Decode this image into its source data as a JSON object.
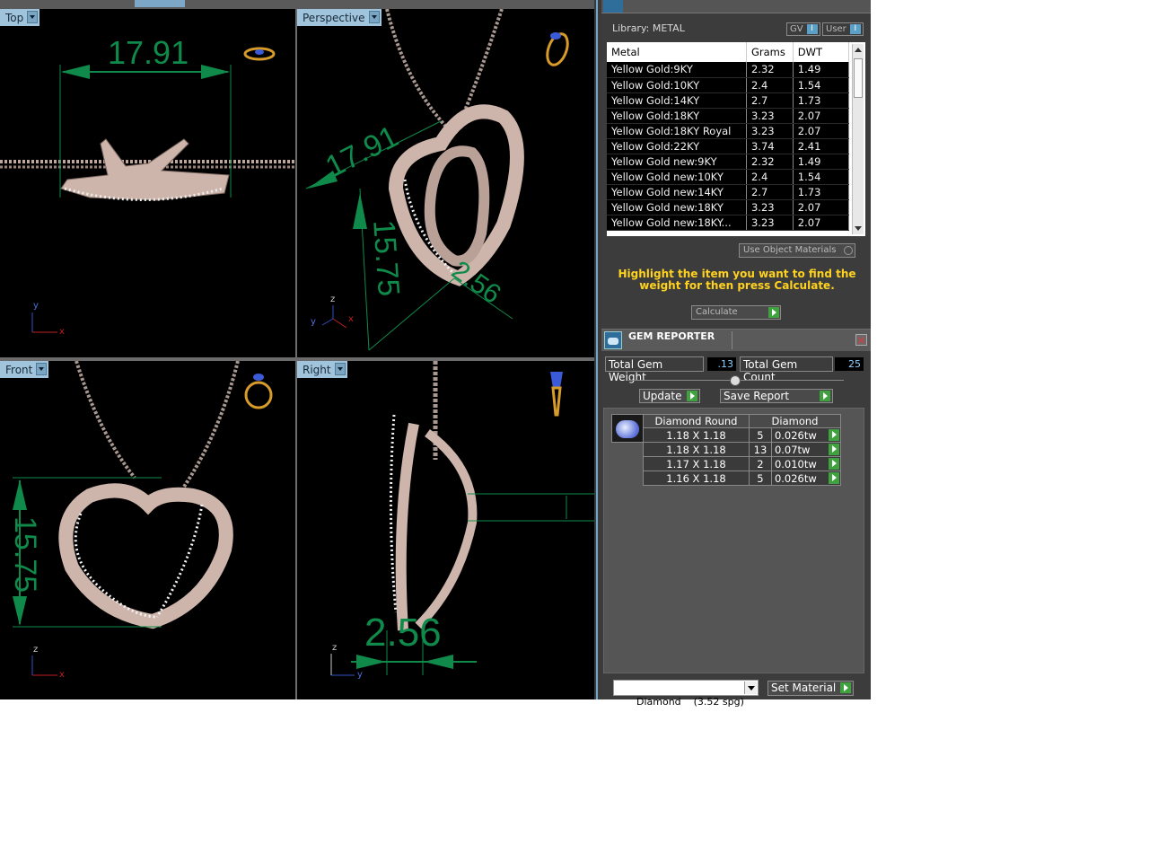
{
  "viewports": {
    "top": {
      "label": "Top",
      "dim": "17.91"
    },
    "perspective": {
      "label": "Perspective",
      "dim_a": "17.91",
      "dim_b": "15.75",
      "dim_c": "2.56"
    },
    "front": {
      "label": "Front",
      "dim": "15.75"
    },
    "right": {
      "label": "Right",
      "dim": "2.56"
    }
  },
  "axes": {
    "x": "x",
    "y": "y",
    "z": "z"
  },
  "metal_panel": {
    "library_label": "Library: METAL",
    "toggle_gv": "GV",
    "toggle_user": "User",
    "toggle_indicator": "I",
    "columns": [
      "Metal",
      "Grams",
      "DWT"
    ],
    "rows": [
      [
        "Yellow Gold:9KY",
        "2.32",
        "1.49"
      ],
      [
        "Yellow Gold:10KY",
        "2.4",
        "1.54"
      ],
      [
        "Yellow Gold:14KY",
        "2.7",
        "1.73"
      ],
      [
        "Yellow Gold:18KY",
        "3.23",
        "2.07"
      ],
      [
        "Yellow Gold:18KY Royal",
        "3.23",
        "2.07"
      ],
      [
        "Yellow Gold:22KY",
        "3.74",
        "2.41"
      ],
      [
        "Yellow Gold new:9KY",
        "2.32",
        "1.49"
      ],
      [
        "Yellow Gold new:10KY",
        "2.4",
        "1.54"
      ],
      [
        "Yellow Gold new:14KY",
        "2.7",
        "1.73"
      ],
      [
        "Yellow Gold new:18KY",
        "3.23",
        "2.07"
      ],
      [
        "Yellow Gold new:18KY...",
        "3.23",
        "2.07"
      ]
    ],
    "use_object_materials": "Use Object Materials",
    "hint": "Highlight the item you want to find the weight for then press Calculate.",
    "calculate": "Calculate"
  },
  "gem_reporter": {
    "title": "GEM REPORTER",
    "total_weight_label": "Total Gem Weight",
    "total_weight_value": ".13",
    "total_count_label": "Total Gem Count",
    "total_count_value": "25",
    "update_label": "Update",
    "save_report_label": "Save Report",
    "columns": [
      "Diamond Round",
      "Diamond"
    ],
    "rows": [
      [
        "1.18 X 1.18",
        "5",
        "0.026tw"
      ],
      [
        "1.18 X 1.18",
        "13",
        "0.07tw"
      ],
      [
        "1.17 X 1.18",
        "2",
        "0.010tw"
      ],
      [
        "1.16 X 1.18",
        "5",
        "0.026tw"
      ]
    ],
    "material_select": "Diamond    (3.52 spg)",
    "set_material_label": "Set Material"
  }
}
